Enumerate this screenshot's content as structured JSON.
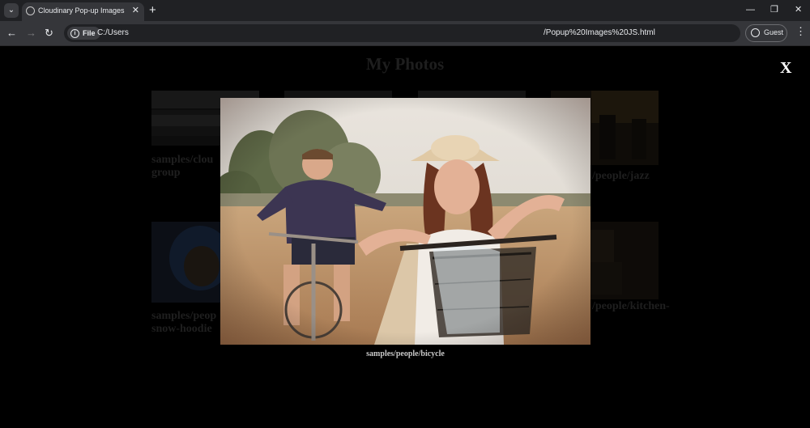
{
  "browser": {
    "tab_title": "Cloudinary Pop-up Images",
    "icons": {
      "tab_menu": "chevron-down-icon",
      "favicon": "globe-icon",
      "close": "close-icon",
      "new_tab": "plus-icon",
      "back": "arrow-left-icon",
      "forward": "arrow-right-icon",
      "reload": "reload-icon",
      "info": "info-icon",
      "profile": "person-icon",
      "menu": "kebab-icon"
    },
    "address": {
      "chip_label": "File",
      "url_start": "C:/Users/",
      "url_end": "/Popup%20Images%20JS.html"
    },
    "profile_label": "Guest"
  },
  "page": {
    "title": "My Photos",
    "thumbnails": [
      {
        "caption_line1": "samples/clou",
        "caption_line2": "group"
      },
      {
        "caption_line1": "",
        "caption_line2": ""
      },
      {
        "caption_line1": "",
        "caption_line2": ""
      },
      {
        "caption_line1": "/people/jazz",
        "caption_line2": ""
      },
      {
        "caption_line1": "samples/peop",
        "caption_line2": "snow-hoodie"
      },
      {
        "caption_line1": "/people/kitchen-",
        "caption_line2": ""
      }
    ]
  },
  "lightbox": {
    "close_label": "X",
    "caption": "samples/people/bicycle"
  },
  "colors": {
    "chrome_dark": "#202124",
    "chrome_toolbar": "#35363a",
    "overlay_bg": "#000000",
    "caption": "#c9c9c9"
  }
}
